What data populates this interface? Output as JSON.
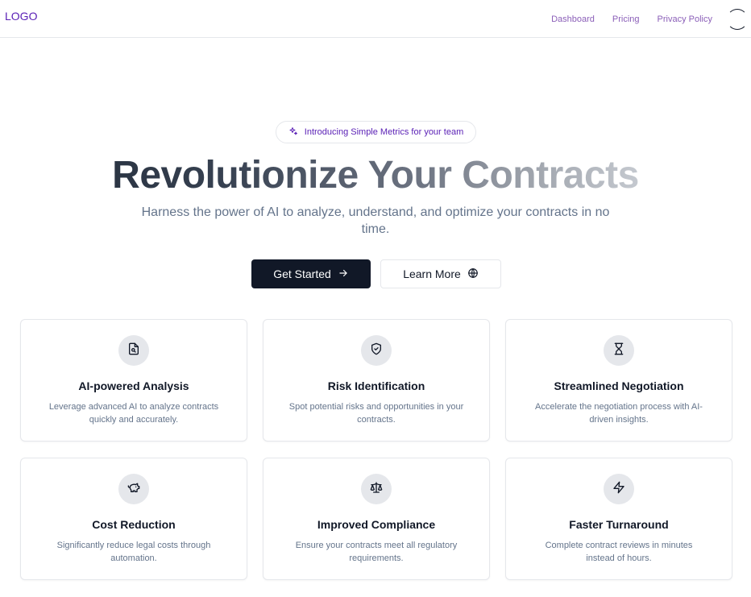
{
  "header": {
    "logo": "LOGO",
    "nav": [
      "Dashboard",
      "Pricing",
      "Privacy Policy"
    ]
  },
  "hero": {
    "pill_text": "Introducing Simple Metrics for your team",
    "headline": "Revolutionize Your Contracts",
    "subhead": "Harness the power of AI to analyze, understand, and optimize your contracts in no time.",
    "primary_button": "Get Started",
    "secondary_button": "Learn More"
  },
  "features": [
    {
      "icon": "document-scan-icon",
      "title": "AI-powered Analysis",
      "desc": "Leverage advanced AI to analyze contracts quickly and accurately."
    },
    {
      "icon": "shield-check-icon",
      "title": "Risk Identification",
      "desc": "Spot potential risks and opportunities in your contracts."
    },
    {
      "icon": "hourglass-icon",
      "title": "Streamlined Negotiation",
      "desc": "Accelerate the negotiation process with AI-driven insights."
    },
    {
      "icon": "piggy-bank-icon",
      "title": "Cost Reduction",
      "desc": "Significantly reduce legal costs through automation."
    },
    {
      "icon": "scale-icon",
      "title": "Improved Compliance",
      "desc": "Ensure your contracts meet all regulatory requirements."
    },
    {
      "icon": "zap-icon",
      "title": "Faster Turnaround",
      "desc": "Complete contract reviews in minutes instead of hours."
    }
  ],
  "colors": {
    "brand_purple": "#5b21b6",
    "nav_link": "#8b5fb8",
    "primary_button_bg": "#111827",
    "muted_text": "#64748b"
  }
}
